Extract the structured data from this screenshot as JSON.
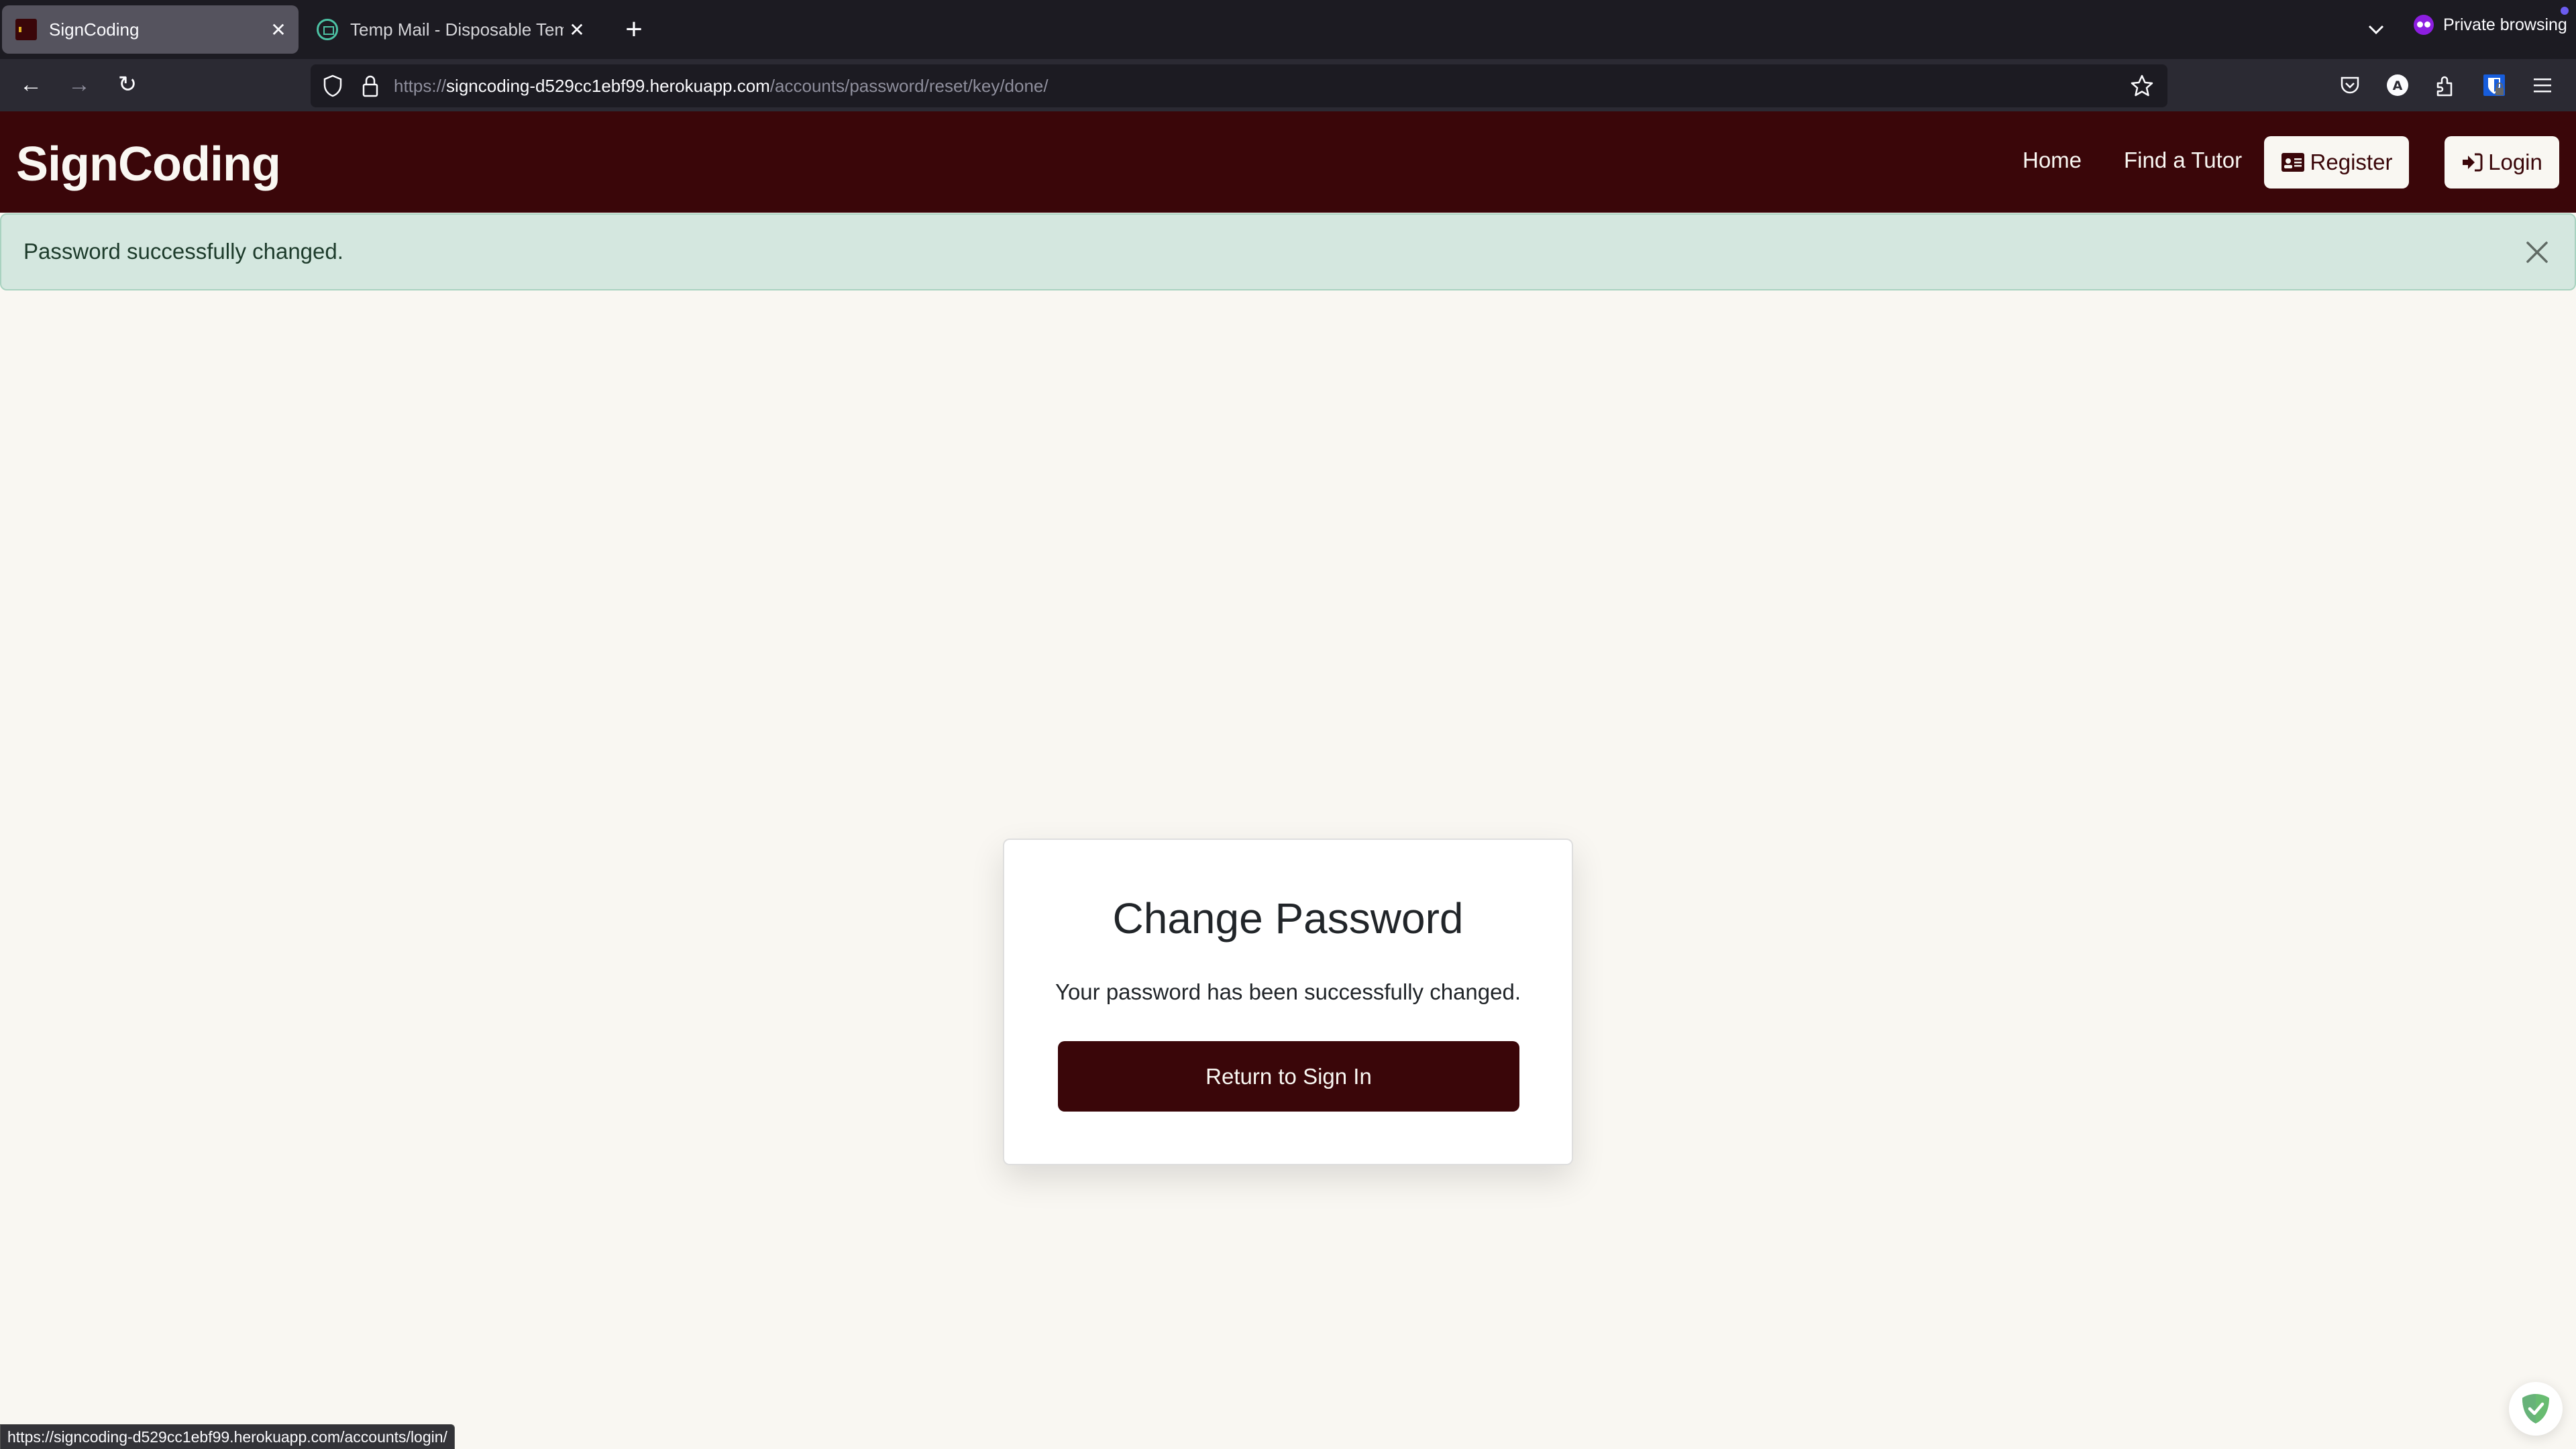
{
  "browser": {
    "tabs": [
      {
        "title": "SignCoding",
        "active": true,
        "favicon": "signcoding-favicon"
      },
      {
        "title": "Temp Mail - Disposable Temporary",
        "active": false,
        "favicon": "temp-mail-favicon"
      }
    ],
    "new_tab_label": "+",
    "tab_close_label": "✕",
    "private_browsing_label": "Private browsing",
    "url": {
      "scheme": "https://",
      "host": "signcoding-d529cc1ebf99.herokuapp.com",
      "path": "/accounts/password/reset/key/done/"
    },
    "nav": {
      "back": "←",
      "forward": "→",
      "reload": "↻"
    },
    "toolbar_icons": [
      "pocket-icon",
      "account-icon",
      "extensions-icon",
      "bitwarden-icon",
      "menu-icon"
    ],
    "status_url": "https://signcoding-d529cc1ebf99.herokuapp.com/accounts/login/"
  },
  "site": {
    "brand": "SignCoding",
    "nav": {
      "home": "Home",
      "find_tutor": "Find a Tutor",
      "register": "Register",
      "login": "Login"
    },
    "alert": {
      "message": "Password successfully changed.",
      "close_label": "×"
    },
    "card": {
      "title": "Change Password",
      "text": "Your password has been successfully changed.",
      "button": "Return to Sign In"
    }
  },
  "colors": {
    "brand": "#3a0609",
    "page_bg": "#f9f7f2",
    "alert_bg": "#d4e7df",
    "alert_text": "#1d3b2b"
  }
}
